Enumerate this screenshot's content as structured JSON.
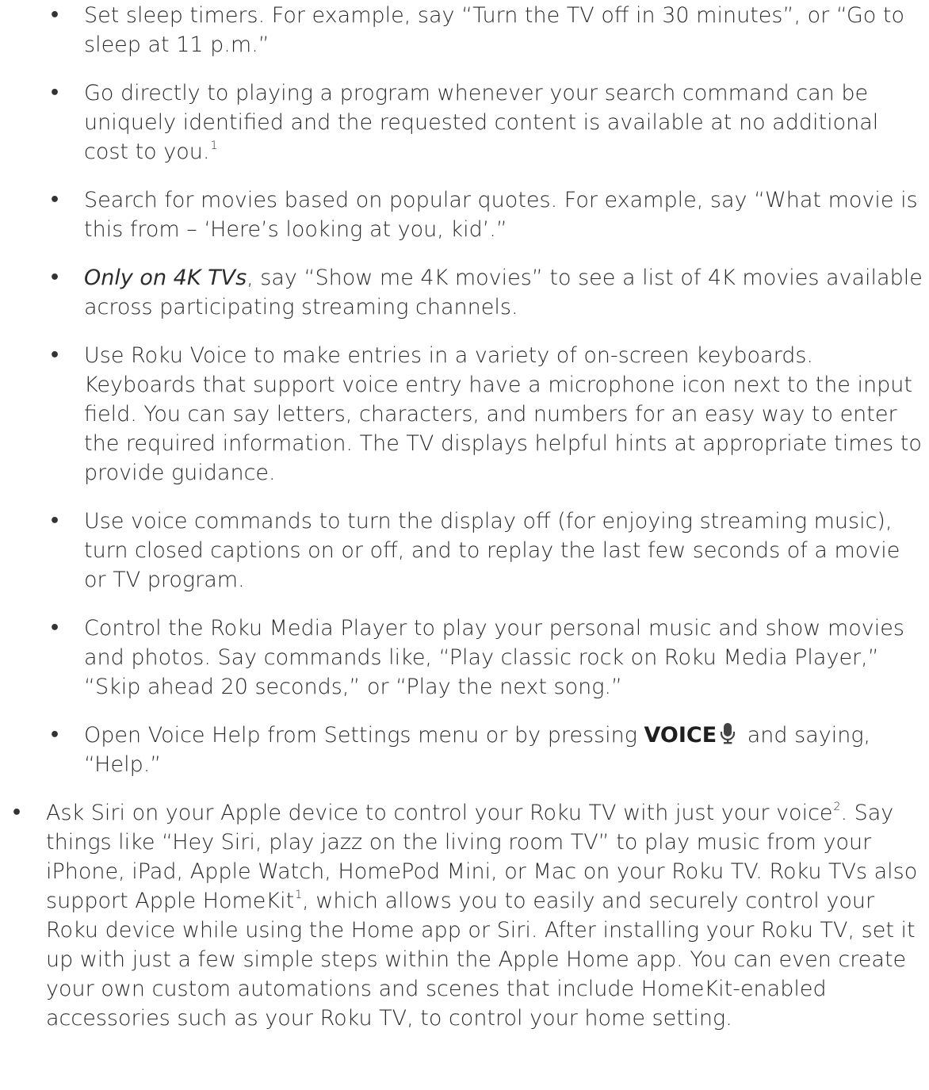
{
  "bullet_char": "•",
  "icons": {
    "mic": "microphone-icon"
  },
  "list": {
    "sleep_timer": {
      "text": "Set sleep timers. For example, say “Turn the TV off in 30 minutes”, or “Go to sleep at 11 p.m.”"
    },
    "direct_play": {
      "text": "Go directly to playing a program whenever your search command can be uniquely identified and the requested content is available at no additional cost to you.",
      "footnote": "1"
    },
    "quotes": {
      "text": "Search for movies based on popular quotes. For example, say “What movie is this from – ‘Here’s looking at you, kid’.”"
    },
    "fourk": {
      "emphasis": "Only on 4K TVs",
      "text": ", say “Show me 4K movies” to see a list of 4K movies available across participating streaming channels."
    },
    "keyboards": {
      "text": "Use Roku Voice to make entries in a variety of on-screen keyboards. Keyboards that support voice entry have a microphone icon next to the input field. You can say letters, characters, and numbers for an easy way to enter the required information. The TV displays helpful hints at appropriate times to provide guidance."
    },
    "display_off": {
      "text": "Use voice commands to turn the display off (for enjoying streaming music), turn closed captions on or off, and to replay the last few seconds of a movie or TV program."
    },
    "media_player": {
      "text": "Control the Roku Media Player to play your personal music and show movies and photos. Say commands like, “Play classic rock on Roku Media Player,” “Skip ahead 20 seconds,” or “Play the next song.”"
    },
    "voice_help": {
      "before": "Open Voice Help from Settings menu or by pressing ",
      "key": "VOICE",
      "after": " and saying, “Help.”"
    },
    "siri": {
      "part1": "Ask Siri on your Apple device to control your Roku TV with just your voice",
      "sup1": "2",
      "part2": ". Say things like “Hey Siri, play jazz on the living room TV” to play music from your iPhone, iPad, Apple Watch, HomePod Mini, or Mac on your Roku TV. Roku TVs also support Apple HomeKit",
      "sup2": "1",
      "part3": ", which allows you to easily and securely control your Roku device while using the Home app or Siri. After installing your Roku TV, set it up with just a few simple steps within the Apple Home app. You can even create your own custom automations and scenes that include HomeKit-enabled accessories such as your Roku TV, to control your home setting."
    }
  }
}
